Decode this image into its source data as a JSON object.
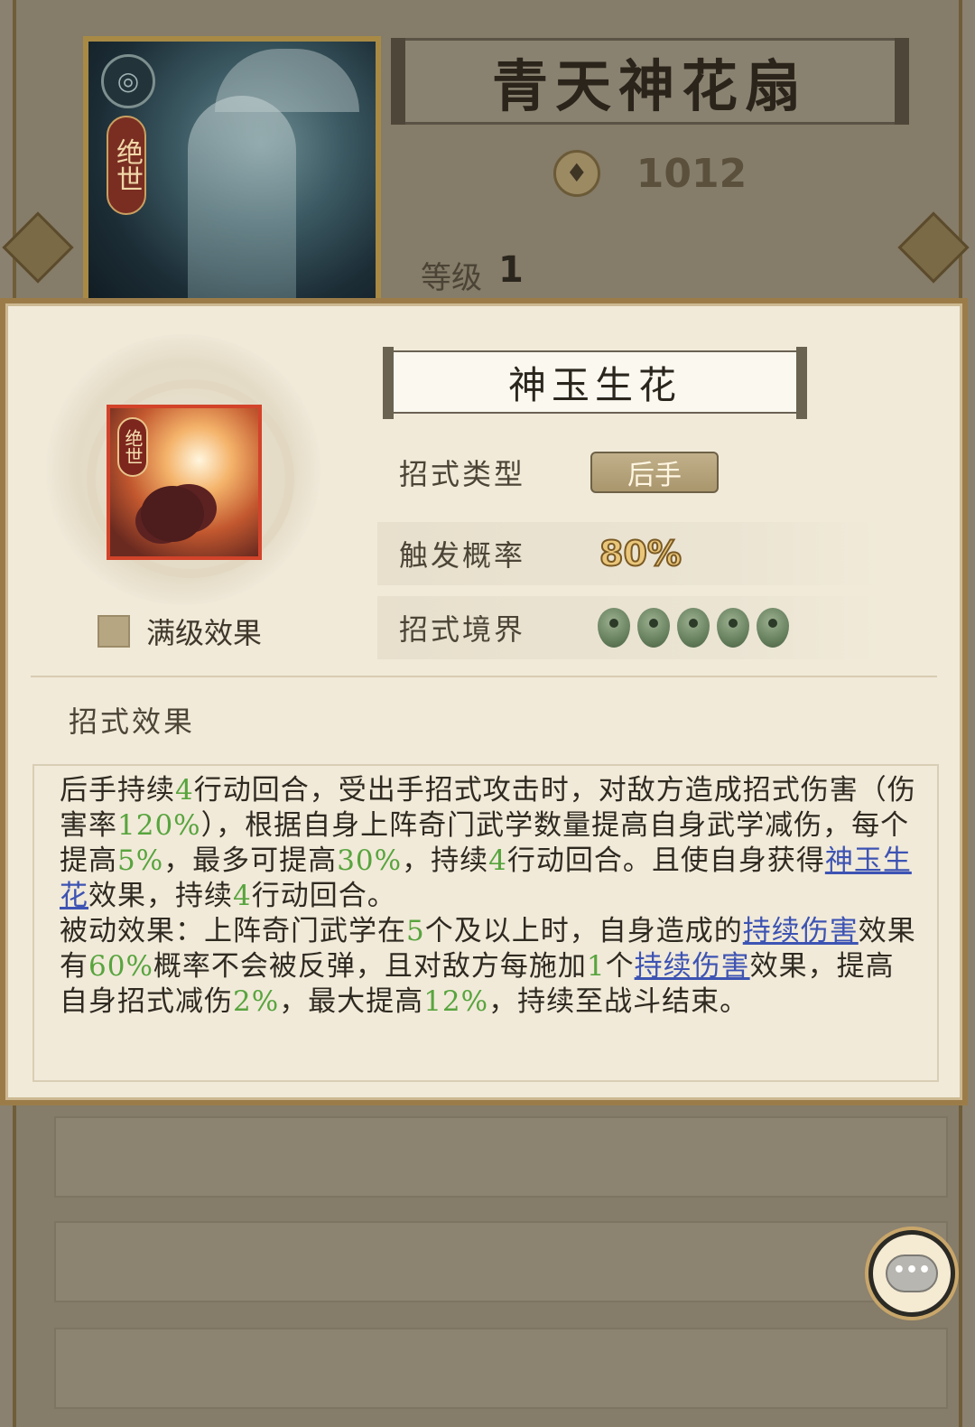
{
  "background": {
    "weapon_title": "青天神花扇",
    "power_value": "1012",
    "level_label": "等级",
    "level_value": "1",
    "rank_badge": "绝世"
  },
  "skill": {
    "name": "神玉生花",
    "rank_badge": "绝世",
    "type_label": "招式类型",
    "type_value": "后手",
    "trigger_label": "触发概率",
    "trigger_value": "80%",
    "realm_label": "招式境界",
    "realm_stars": 5,
    "max_level_label": "满级效果",
    "effects_heading": "招式效果"
  },
  "description": {
    "p1": [
      {
        "t": "后手持续",
        "s": "n"
      },
      {
        "t": "4",
        "s": "g"
      },
      {
        "t": "行动回合，受出手招式攻击时，对敌方造成招式伤害（伤害率",
        "s": "n"
      },
      {
        "t": "120%",
        "s": "g"
      },
      {
        "t": "），根据自身上阵奇门武学数量提高自身武学减伤，每个提高",
        "s": "n"
      },
      {
        "t": "5%",
        "s": "g"
      },
      {
        "t": "，最多可提高",
        "s": "n"
      },
      {
        "t": "30%",
        "s": "g"
      },
      {
        "t": "，持续",
        "s": "n"
      },
      {
        "t": "4",
        "s": "g"
      },
      {
        "t": "行动回合。且使自身获得",
        "s": "n"
      },
      {
        "t": "神玉生花",
        "s": "link"
      },
      {
        "t": "效果，持续",
        "s": "n"
      },
      {
        "t": "4",
        "s": "g"
      },
      {
        "t": "行动回合。",
        "s": "n"
      }
    ],
    "p2": [
      {
        "t": "被动效果：上阵奇门武学在",
        "s": "n"
      },
      {
        "t": "5",
        "s": "g"
      },
      {
        "t": "个及以上时，自身造成的",
        "s": "n"
      },
      {
        "t": "持续伤害",
        "s": "link"
      },
      {
        "t": "效果有",
        "s": "n"
      },
      {
        "t": "60%",
        "s": "g"
      },
      {
        "t": "概率不会被反弹，且对敌方每施加",
        "s": "n"
      },
      {
        "t": "1",
        "s": "g"
      },
      {
        "t": "个",
        "s": "n"
      },
      {
        "t": "持续伤害",
        "s": "link"
      },
      {
        "t": "效果，提高自身招式减伤",
        "s": "n"
      },
      {
        "t": "2%",
        "s": "g"
      },
      {
        "t": "，最大提高",
        "s": "n"
      },
      {
        "t": "12%",
        "s": "g"
      },
      {
        "t": "，持续至战斗结束。",
        "s": "n"
      }
    ]
  },
  "colors": {
    "highlight_green": "#58a43e",
    "link_blue": "#3d53b3",
    "panel_bg": "#f1ead9",
    "frame_gold": "#9b7c49"
  },
  "chat": {
    "icon_text": "•••"
  }
}
